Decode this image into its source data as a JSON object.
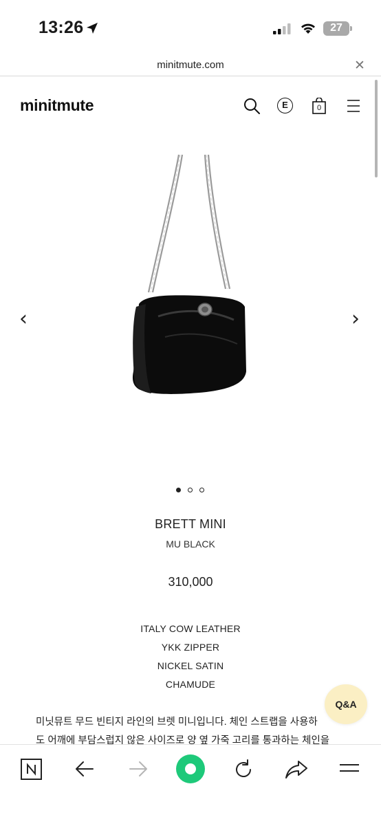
{
  "status_bar": {
    "time": "13:26",
    "battery": "27"
  },
  "browser": {
    "url": "minitmute.com"
  },
  "site": {
    "logo": "minitmute",
    "cart_count": "0",
    "currency_badge": "E"
  },
  "product": {
    "name": "BRETT MINI",
    "color": "MU BLACK",
    "price": "310,000",
    "specs": [
      "ITALY COW LEATHER",
      "YKK ZIPPER",
      "NICKEL SATIN",
      "CHAMUDE"
    ],
    "description": [
      "미닛뮤트 무드 빈티지 라인의 브렛 미니입니다. 체인 스트랩을 사용하",
      "도 어깨에 부담스럽지 않은 사이즈로 양 옆 가죽 고리를 통과하는 체인을"
    ]
  },
  "carousel": {
    "total": 3,
    "active": 0
  },
  "floating": {
    "qna_label": "Q&A"
  },
  "icons": {
    "header": [
      "search-icon",
      "currency-icon",
      "cart-icon",
      "menu-icon"
    ],
    "toolbar": [
      "naver-home-icon",
      "back-icon",
      "forward-icon",
      "green-dot-icon",
      "reload-icon",
      "share-icon",
      "menu-icon"
    ]
  },
  "colors": {
    "accent_green": "#1ec97a",
    "qna_bg": "#fbefc4"
  }
}
